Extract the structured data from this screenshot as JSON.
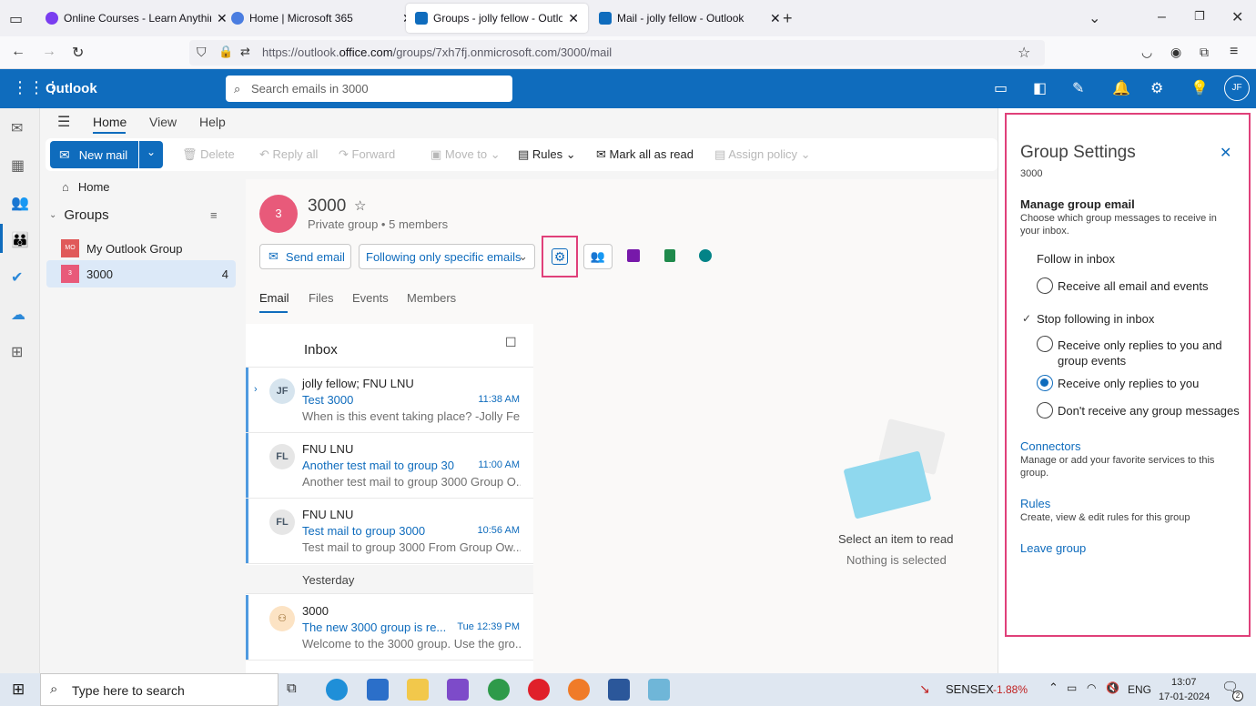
{
  "browser": {
    "tabs": [
      {
        "title": "Online Courses - Learn Anything",
        "color": "#7a3df0"
      },
      {
        "title": "Home | Microsoft 365",
        "color": "#4a7de0"
      },
      {
        "title": "Groups - jolly fellow - Outlook",
        "color": "#0f6cbd"
      },
      {
        "title": "Mail - jolly fellow - Outlook",
        "color": "#0f6cbd"
      }
    ],
    "url_prefix": "https://outlook.",
    "url_domain": "office.com",
    "url_path": "/groups/7xh7fj.onmicrosoft.com/3000/mail"
  },
  "outlook": {
    "app_name": "Outlook",
    "search_placeholder": "Search emails in 3000",
    "avatar_initials": "JF"
  },
  "ribbon": {
    "tabs": [
      "Home",
      "View",
      "Help"
    ],
    "new_mail": "New mail",
    "delete": "Delete",
    "reply_all": "Reply all",
    "forward": "Forward",
    "move_to": "Move to",
    "rules": "Rules",
    "mark_all_read": "Mark all as read",
    "assign_policy": "Assign policy"
  },
  "folders": {
    "home": "Home",
    "groups_heading": "Groups",
    "groups": [
      {
        "name": "My Outlook Group",
        "badge": "MO",
        "count": ""
      },
      {
        "name": "3000",
        "badge": "3",
        "count": "4"
      }
    ]
  },
  "group": {
    "initial": "3",
    "name": "3000",
    "meta": "Private group • 5 members",
    "send_email": "Send email",
    "follow_state": "Following only specific emails",
    "tabs": [
      "Email",
      "Files",
      "Events",
      "Members"
    ]
  },
  "inbox": {
    "title": "Inbox",
    "messages": [
      {
        "initials": "JF",
        "sender": "jolly fellow; FNU LNU",
        "subject": "Test 3000",
        "time": "11:38 AM",
        "preview": "When is this event taking place? -Jolly Fel..."
      },
      {
        "initials": "FL",
        "sender": "FNU LNU",
        "subject": "Another test mail to group 30...",
        "time": "11:00 AM",
        "preview": "Another test mail to group 3000 Group O..."
      },
      {
        "initials": "FL",
        "sender": "FNU LNU",
        "subject": "Test mail to group 3000",
        "time": "10:56 AM",
        "preview": "Test mail to group 3000 From Group Ow..."
      }
    ],
    "yesterday_label": "Yesterday",
    "yesterday_message": {
      "sender": "3000",
      "subject": "The new 3000 group is re...",
      "time": "Tue 12:39 PM",
      "preview": "Welcome to the 3000 group. Use the gro..."
    }
  },
  "reading_pane": {
    "title": "Select an item to read",
    "subtitle": "Nothing is selected"
  },
  "settings": {
    "title": "Group Settings",
    "subtitle": "3000",
    "manage_heading": "Manage group email",
    "manage_desc": "Choose which group messages to receive in your inbox.",
    "follow_in_inbox": "Follow in inbox",
    "opt_all": "Receive all email and events",
    "stop_following": "Stop following in inbox",
    "opt_replies_events": "Receive only replies to you and group events",
    "opt_replies": "Receive only replies to you",
    "opt_none": "Don't receive any group messages",
    "connectors": "Connectors",
    "connectors_desc": "Manage or add your favorite services to this group.",
    "rules": "Rules",
    "rules_desc": "Create, view & edit rules for this group",
    "leave": "Leave group"
  },
  "taskbar": {
    "search_placeholder": "Type here to search",
    "ticker_name": "SENSEX",
    "ticker_value": "-1.88%",
    "language": "ENG",
    "time": "13:07",
    "date": "17-01-2024",
    "notifications": "2"
  }
}
